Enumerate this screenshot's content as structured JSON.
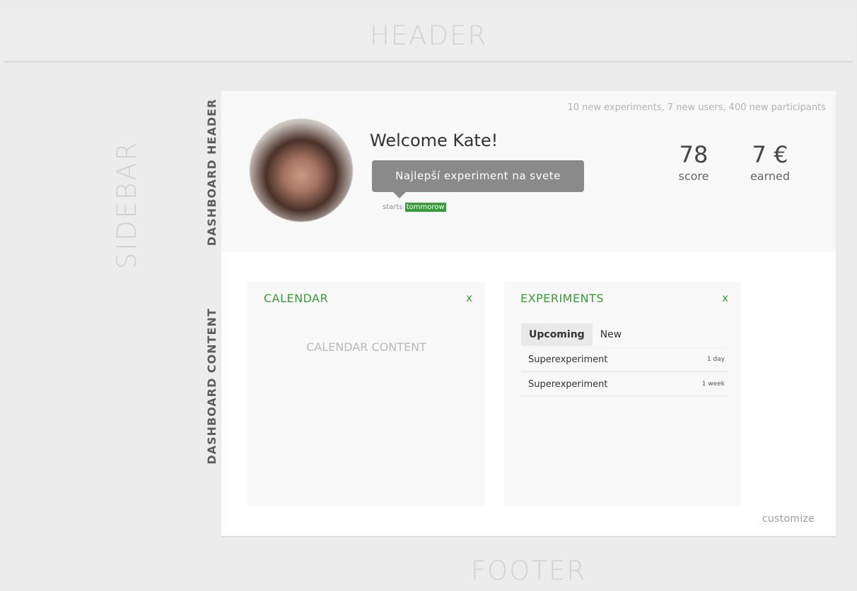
{
  "labels": {
    "header": "HEADER",
    "sidebar": "SIDEBAR",
    "dashboard_header": "DASHBOARD HEADER",
    "dashboard_content": "DASHBOARD CONTENT",
    "footer": "FOOTER"
  },
  "dashboard_header": {
    "news": "10 new experiments, 7 new users, 400 new participants",
    "avatar_icon": "user-photo",
    "welcome": "Welcome Kate!",
    "tooltip": "Najlepší experiment na svete",
    "starts_prefix": "starts",
    "starts_when": "tommorow",
    "stats": {
      "score_value": "78",
      "score_label": "score",
      "earned_value": "7 €",
      "earned_label": "earned"
    }
  },
  "widgets": {
    "calendar": {
      "title": "CALENDAR",
      "close": "x",
      "content": "CALENDAR CONTENT"
    },
    "experiments": {
      "title": "EXPERIMENTS",
      "close": "x",
      "tabs": [
        "Upcoming",
        "New"
      ],
      "active_tab": "Upcoming",
      "rows": [
        {
          "name": "Superexperiment",
          "time": "1 day"
        },
        {
          "name": "Superexperiment",
          "time": "1 week"
        }
      ]
    }
  },
  "customize": "customize",
  "colors": {
    "accent_green": "#3a9a3c",
    "tooltip_gray": "#8a8a8a",
    "page_bg": "#ececec"
  }
}
